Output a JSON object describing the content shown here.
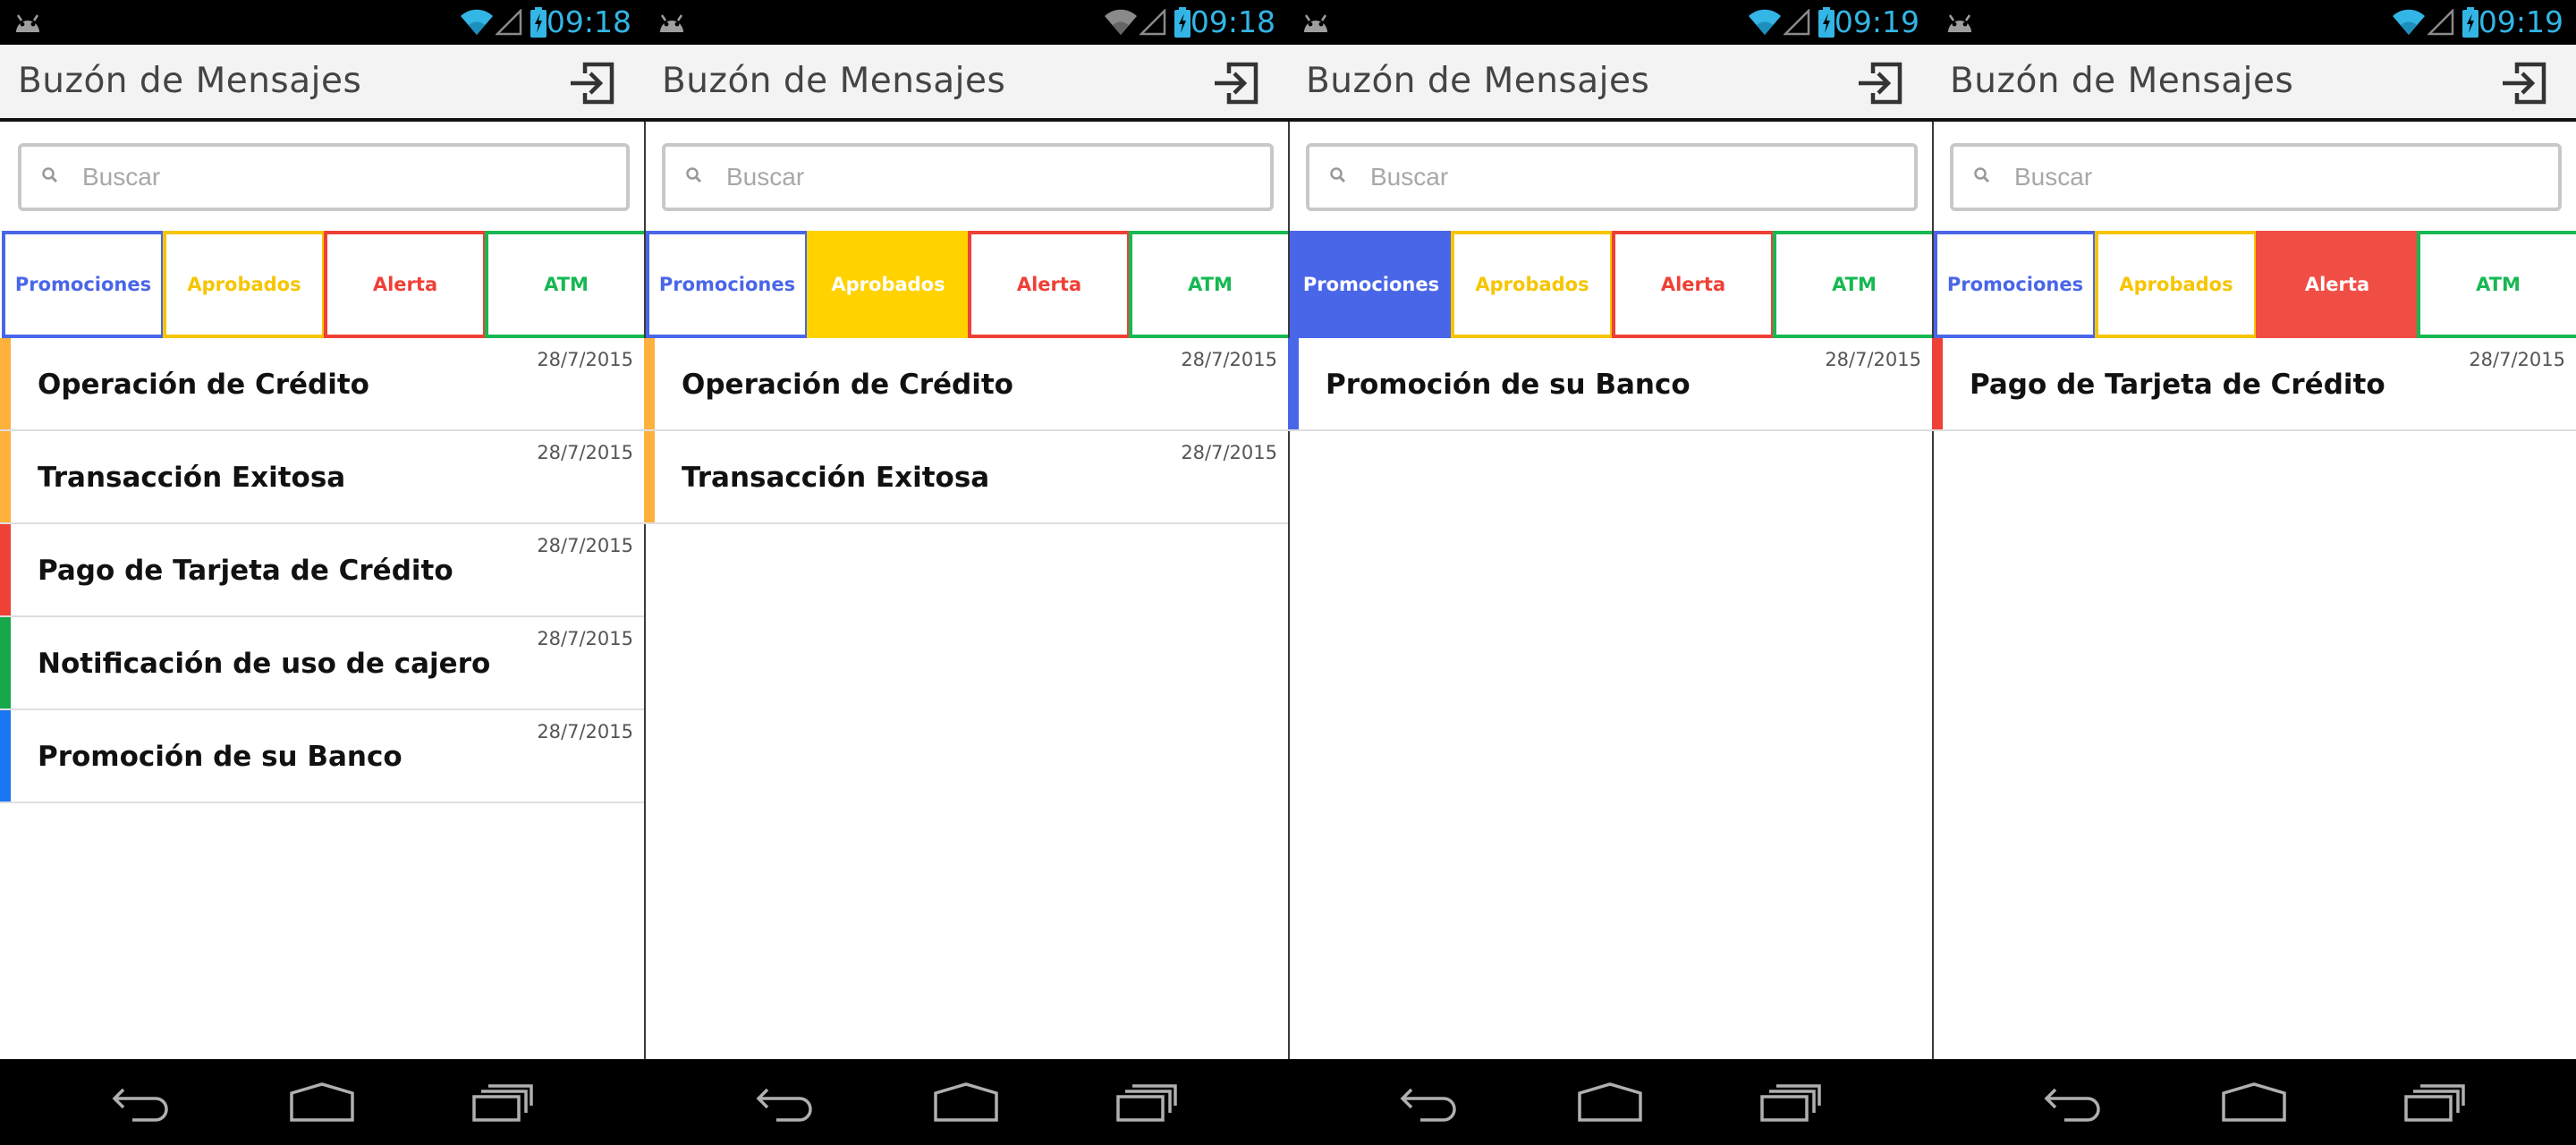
{
  "colors": {
    "promociones": "#4a66e8",
    "aprobados": "#f7c500",
    "alerta": "#ef4036",
    "atm": "#16b852",
    "bar_orange": "#ffb13d",
    "bar_red": "#ef4036",
    "bar_green": "#16a84b",
    "bar_blue": "#1976f2",
    "status_clock": "#33b5e5"
  },
  "screens": [
    {
      "status": {
        "time": "09:18"
      },
      "header": {
        "title": "Buzón de Mensajes",
        "logout_icon": "logout-icon"
      },
      "search": {
        "placeholder": "Buscar",
        "value": ""
      },
      "active_filter": "none",
      "tabs": [
        {
          "label": "Promociones",
          "color": "blue",
          "active": false
        },
        {
          "label": "Aprobados",
          "color": "yellow",
          "active": false
        },
        {
          "label": "Alerta",
          "color": "red",
          "active": false
        },
        {
          "label": "ATM",
          "color": "green",
          "active": false
        }
      ],
      "messages": [
        {
          "title": "Operación de Crédito",
          "date": "28/7/2015",
          "category_color": "orange"
        },
        {
          "title": "Transacción Exitosa",
          "date": "28/7/2015",
          "category_color": "orange"
        },
        {
          "title": "Pago de Tarjeta de Crédito",
          "date": "28/7/2015",
          "category_color": "red"
        },
        {
          "title": "Notificación de uso de cajero",
          "date": "28/7/2015",
          "category_color": "green"
        },
        {
          "title": "Promoción de su Banco",
          "date": "28/7/2015",
          "category_color": "blue"
        }
      ]
    },
    {
      "status": {
        "time": "09:18"
      },
      "header": {
        "title": "Buzón de Mensajes",
        "logout_icon": "logout-icon"
      },
      "search": {
        "placeholder": "Buscar",
        "value": ""
      },
      "active_filter": "Aprobados",
      "tabs": [
        {
          "label": "Promociones",
          "color": "blue",
          "active": false
        },
        {
          "label": "Aprobados",
          "color": "yellow",
          "active": true
        },
        {
          "label": "Alerta",
          "color": "red",
          "active": false
        },
        {
          "label": "ATM",
          "color": "green",
          "active": false
        }
      ],
      "messages": [
        {
          "title": "Operación de Crédito",
          "date": "28/7/2015",
          "category_color": "orange"
        },
        {
          "title": "Transacción Exitosa",
          "date": "28/7/2015",
          "category_color": "orange"
        }
      ]
    },
    {
      "status": {
        "time": "09:19"
      },
      "header": {
        "title": "Buzón de Mensajes",
        "logout_icon": "logout-icon"
      },
      "search": {
        "placeholder": "Buscar",
        "value": ""
      },
      "active_filter": "Promociones",
      "tabs": [
        {
          "label": "Promociones",
          "color": "blue",
          "active": true
        },
        {
          "label": "Aprobados",
          "color": "yellow",
          "active": false
        },
        {
          "label": "Alerta",
          "color": "red",
          "active": false
        },
        {
          "label": "ATM",
          "color": "green",
          "active": false
        }
      ],
      "messages": [
        {
          "title": "Promoción de su Banco",
          "date": "28/7/2015",
          "category_color": "blue"
        }
      ]
    },
    {
      "status": {
        "time": "09:19"
      },
      "header": {
        "title": "Buzón de Mensajes",
        "logout_icon": "logout-icon"
      },
      "search": {
        "placeholder": "Buscar",
        "value": ""
      },
      "active_filter": "Alerta",
      "tabs": [
        {
          "label": "Promociones",
          "color": "blue",
          "active": false
        },
        {
          "label": "Aprobados",
          "color": "yellow",
          "active": false
        },
        {
          "label": "Alerta",
          "color": "red",
          "active": true
        },
        {
          "label": "ATM",
          "color": "green",
          "active": false
        }
      ],
      "messages": [
        {
          "title": "Pago de Tarjeta de Crédito",
          "date": "28/7/2015",
          "category_color": "red"
        }
      ]
    }
  ]
}
